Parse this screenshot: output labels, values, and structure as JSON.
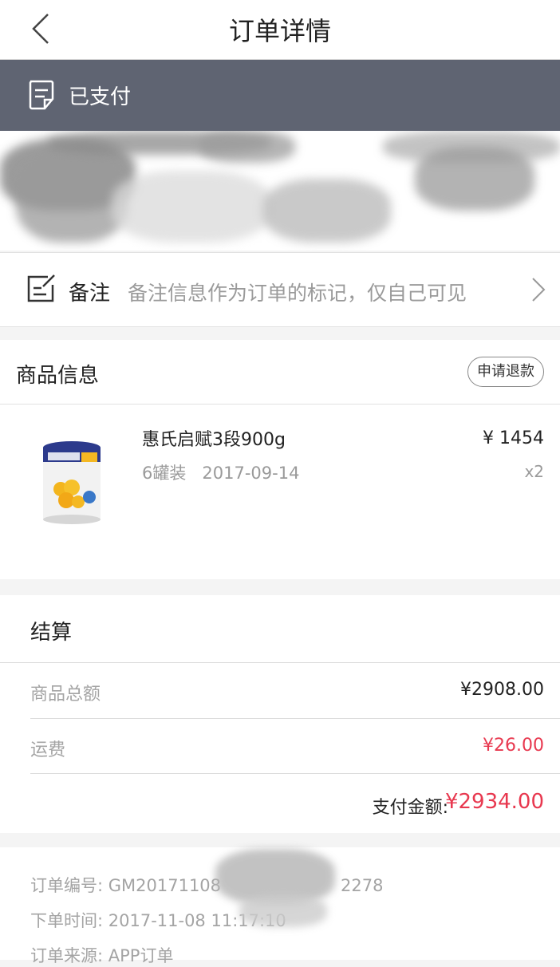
{
  "nav": {
    "title": "订单详情"
  },
  "status": {
    "label": "已支付"
  },
  "note": {
    "label": "备注",
    "placeholder": "备注信息作为订单的标记，仅自己可见"
  },
  "goods": {
    "section_title": "商品信息",
    "refund_label": "申请退款",
    "item": {
      "name": "惠氏启赋3段900g",
      "spec": "6罐装",
      "date": "2017-09-14",
      "price": "¥ 1454",
      "qty": "x2"
    }
  },
  "settlement": {
    "title": "结算",
    "subtotal_label": "商品总额",
    "subtotal_value": "¥2908.00",
    "shipping_label": "运费",
    "shipping_value": "¥26.00",
    "total_label": "支付金额:",
    "total_value": "¥2934.00"
  },
  "order_info": {
    "order_no": "订单编号: GM20171108",
    "order_no_tail": "2278",
    "order_time": "下单时间: 2017-11-08 11:17:10",
    "order_source": "订单来源:  APP订单"
  },
  "colors": {
    "status_bg": "#5f6472",
    "accent_red": "#e8384f"
  }
}
